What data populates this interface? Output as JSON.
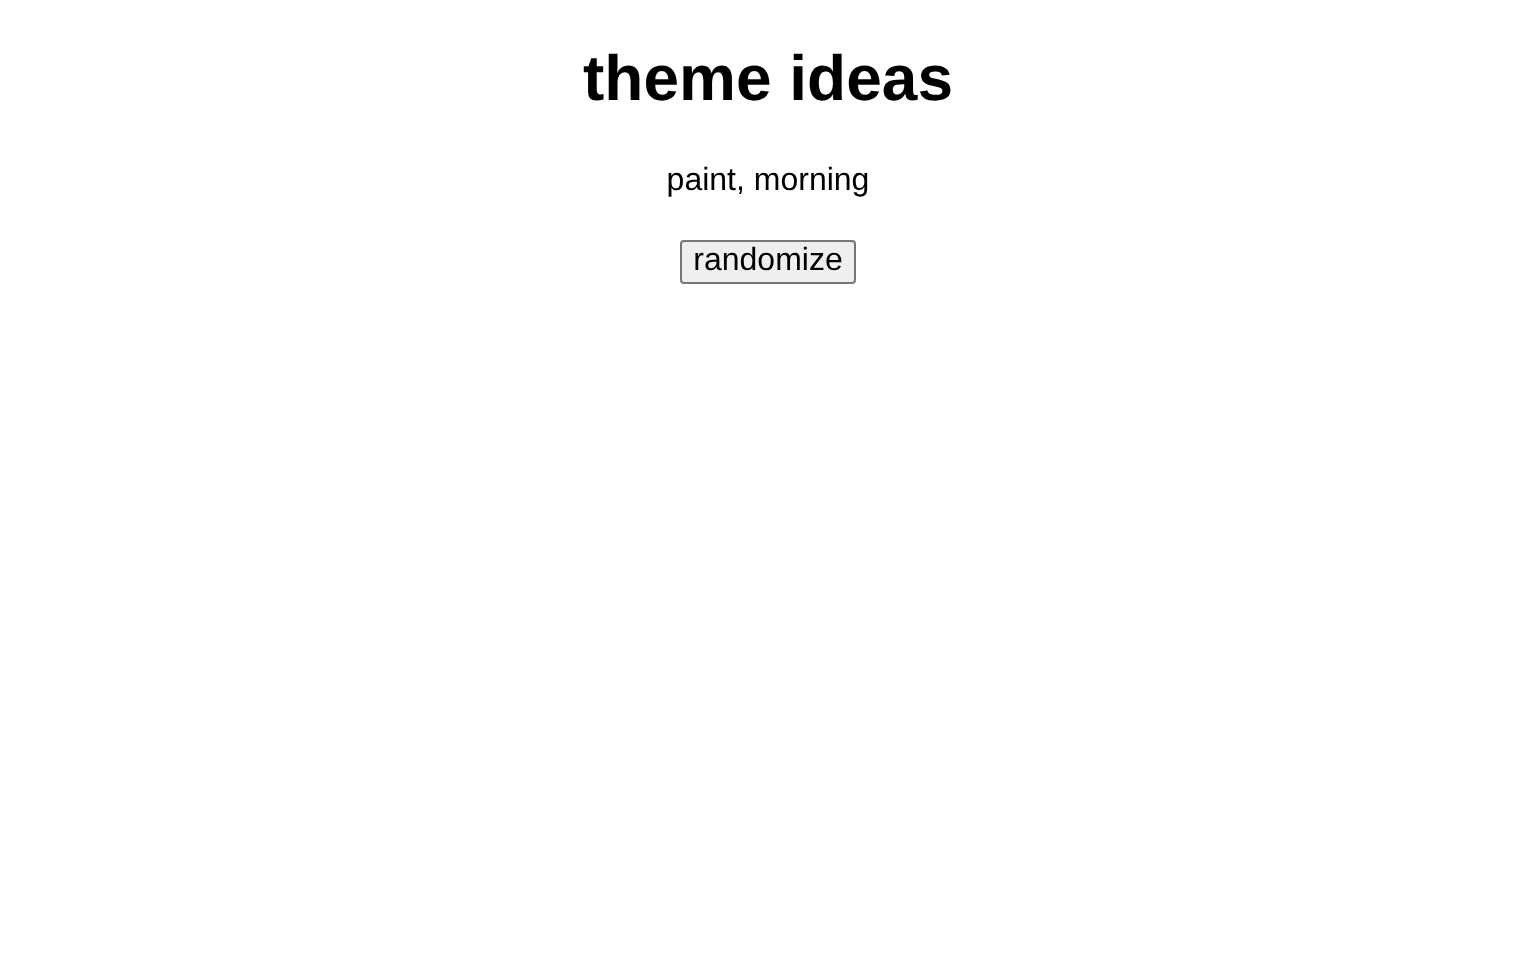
{
  "title": "theme ideas",
  "ideas": "paint, morning",
  "button": "randomize"
}
